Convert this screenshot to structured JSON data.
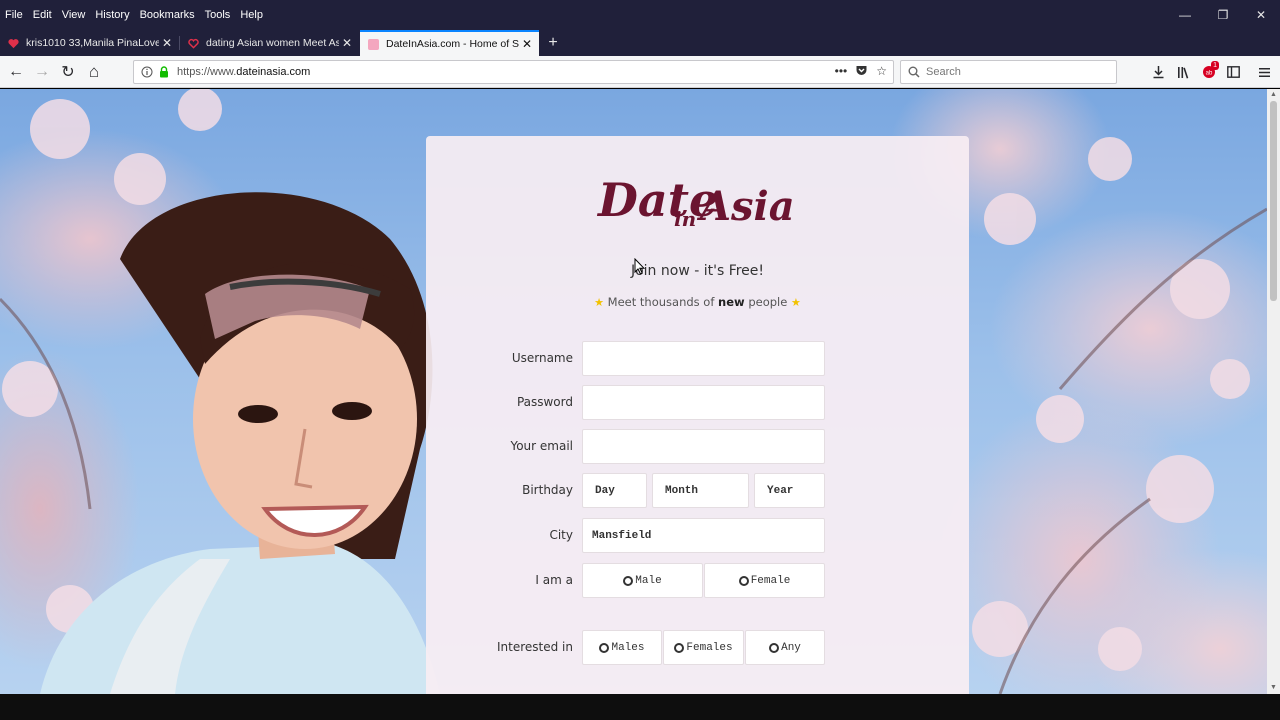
{
  "menu": [
    "File",
    "Edit",
    "View",
    "History",
    "Bookmarks",
    "Tools",
    "Help"
  ],
  "window_buttons": {
    "minimize": "—",
    "restore": "❐",
    "close": "✕"
  },
  "tabs": [
    {
      "title": "kris1010 33,Manila PinaLove",
      "close": "✕"
    },
    {
      "title": "dating Asian women Meet Asian",
      "close": "✕"
    },
    {
      "title": "DateInAsia.com - Home of Sing",
      "close": "✕"
    }
  ],
  "new_tab": "+",
  "nav": {
    "back": "←",
    "forward": "→",
    "reload": "↻",
    "home": "⌂"
  },
  "url": {
    "scheme": "https://www.",
    "host": "dateinasia.com"
  },
  "url_icons": [
    "•••",
    "♥",
    "☆"
  ],
  "search": {
    "placeholder": "Search",
    "icon": "search-icon"
  },
  "toolbar_badge": "1",
  "page": {
    "logo_main": "Date",
    "logo_in": "in",
    "logo_asia": "Asia",
    "headline": "Join now - it's Free!",
    "sub_before": "Meet thousands of",
    "sub_bold": "new",
    "sub_after": "people",
    "star": "★",
    "form": {
      "username_label": "Username",
      "password_label": "Password",
      "email_label": "Your email",
      "birthday_label": "Birthday",
      "day": "Day",
      "month": "Month",
      "year": "Year",
      "city_label": "City",
      "city_value": "Mansfield",
      "iama_label": "I am a",
      "male": "Male",
      "female": "Female",
      "interested_label": "Interested in",
      "males": "Males",
      "females": "Females",
      "any": "Any"
    }
  },
  "colors": {
    "brand": "#6b1430",
    "tab_accent": "#0a84ff",
    "chrome_dark": "#20203a",
    "star": "#f2c200"
  }
}
